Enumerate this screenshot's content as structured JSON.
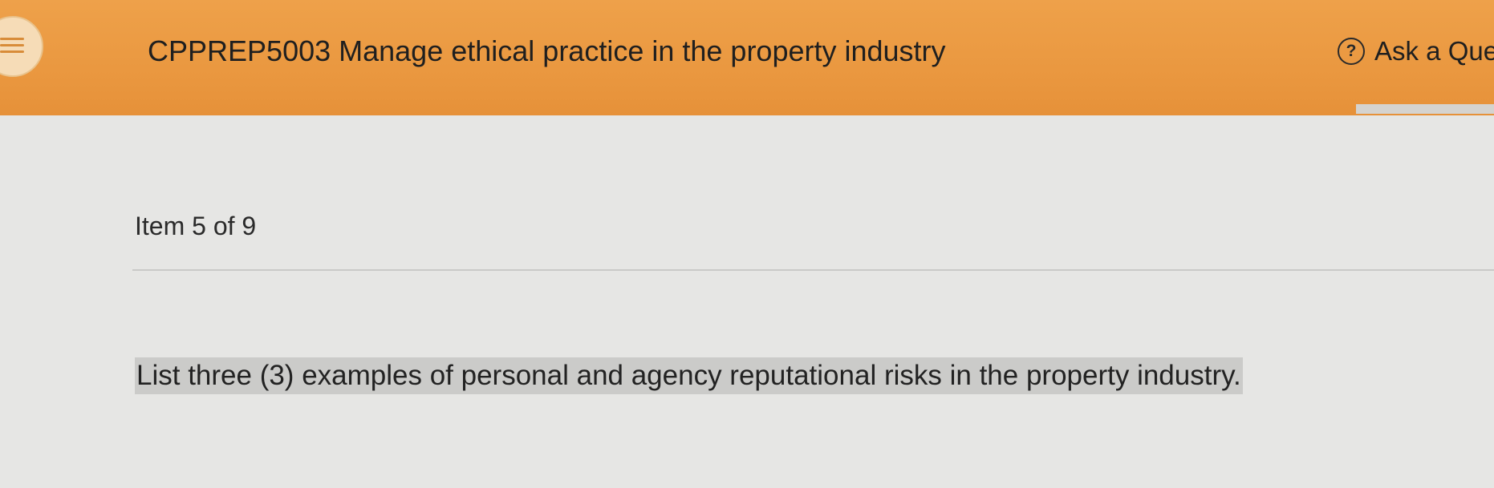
{
  "header": {
    "menu_icon": "hamburger-menu-icon",
    "course_title": "CPPREP5003 Manage ethical practice in the property industry",
    "ask_question": {
      "icon": "help-circle-icon",
      "icon_glyph": "?",
      "label": "Ask a Que"
    },
    "background_color": "#EA9840"
  },
  "main": {
    "item_counter": "Item 5 of 9",
    "question": "List three (3) examples of personal and agency reputational risks in the property industry."
  }
}
